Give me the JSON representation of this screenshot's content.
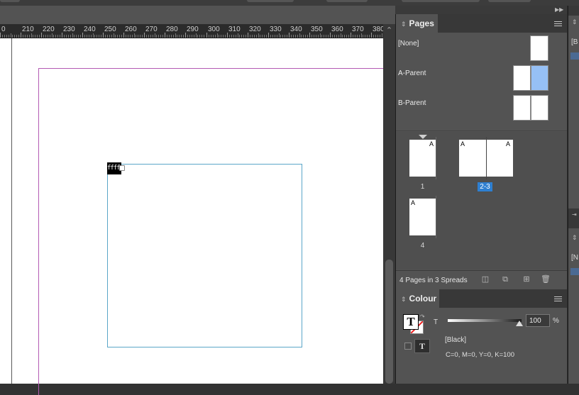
{
  "ruler": {
    "labels": [
      "0",
      "210",
      "220",
      "230",
      "240",
      "250",
      "260",
      "270",
      "280",
      "290",
      "300",
      "310",
      "320",
      "330",
      "340",
      "350",
      "360",
      "370",
      "380"
    ]
  },
  "text_frame": {
    "overset_tag": "ffffff"
  },
  "pages_panel": {
    "title": "Pages",
    "parents": [
      {
        "label": "[None]"
      },
      {
        "label": "A-Parent"
      },
      {
        "label": "B-Parent"
      }
    ],
    "pages": [
      {
        "number": "1",
        "parent_prefix": "A"
      },
      {
        "number": "2-3",
        "left_prefix": "A",
        "right_prefix": "A",
        "selected": true
      },
      {
        "number": "4",
        "parent_prefix": "A"
      }
    ],
    "footer_status": "4 Pages in 3 Spreads"
  },
  "colour_panel": {
    "title": "Colour",
    "fill_glyph": "T",
    "tint_label": "T",
    "tint_value": "100",
    "tint_unit": "%",
    "swatch_name": "[Black]",
    "swatch_values": "C=0, M=0, Y=0, K=100",
    "format_glyph": "T"
  },
  "side_strip": {
    "labels": [
      "[B",
      "[N"
    ]
  },
  "colors": {
    "margin_guide": "#b35ab3",
    "frame_edge": "#5aa6c8",
    "selection_blue": "#2e7fd1",
    "parent_selected": "#96c0f5"
  }
}
